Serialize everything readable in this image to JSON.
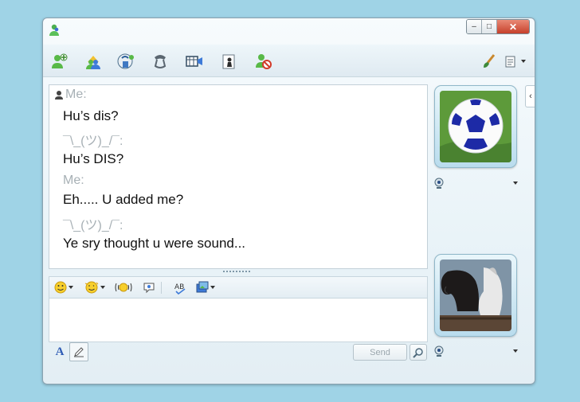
{
  "window": {
    "controls": {
      "minimize": "–",
      "maximize": "□",
      "close": "✕"
    }
  },
  "toolbar": {
    "items": [
      {
        "name": "add-contact-icon"
      },
      {
        "name": "invite-icon"
      },
      {
        "name": "share-files-icon"
      },
      {
        "name": "call-icon"
      },
      {
        "name": "video-icon"
      },
      {
        "name": "games-icon"
      },
      {
        "name": "block-icon"
      },
      {
        "name": "paintbrush-icon"
      },
      {
        "name": "show-menu-icon"
      }
    ]
  },
  "conversation": [
    {
      "type": "sender",
      "text": "Me:"
    },
    {
      "type": "message",
      "text": "Hu’s dis?"
    },
    {
      "type": "sender",
      "text": "¯\\_(ツ)_/¯:"
    },
    {
      "type": "message",
      "text": "Hu’s DIS?"
    },
    {
      "type": "sender",
      "text": "Me:"
    },
    {
      "type": "message",
      "text": "Eh..... U added me?"
    },
    {
      "type": "sender",
      "text": "¯\\_(ツ)_/¯:"
    },
    {
      "type": "message",
      "text": "Ye sry thought u were sound..."
    }
  ],
  "compose": {
    "send_label": "Send",
    "input_value": ""
  },
  "format_toolbar": {
    "items": [
      "emoticons-icon",
      "winks-icon",
      "nudge-icon",
      "voice-clip-icon",
      "spellcheck-icon",
      "backgrounds-icon"
    ]
  },
  "avatars": {
    "contact": {
      "name": "soccer-ball-avatar"
    },
    "self": {
      "name": "horses-avatar"
    }
  }
}
